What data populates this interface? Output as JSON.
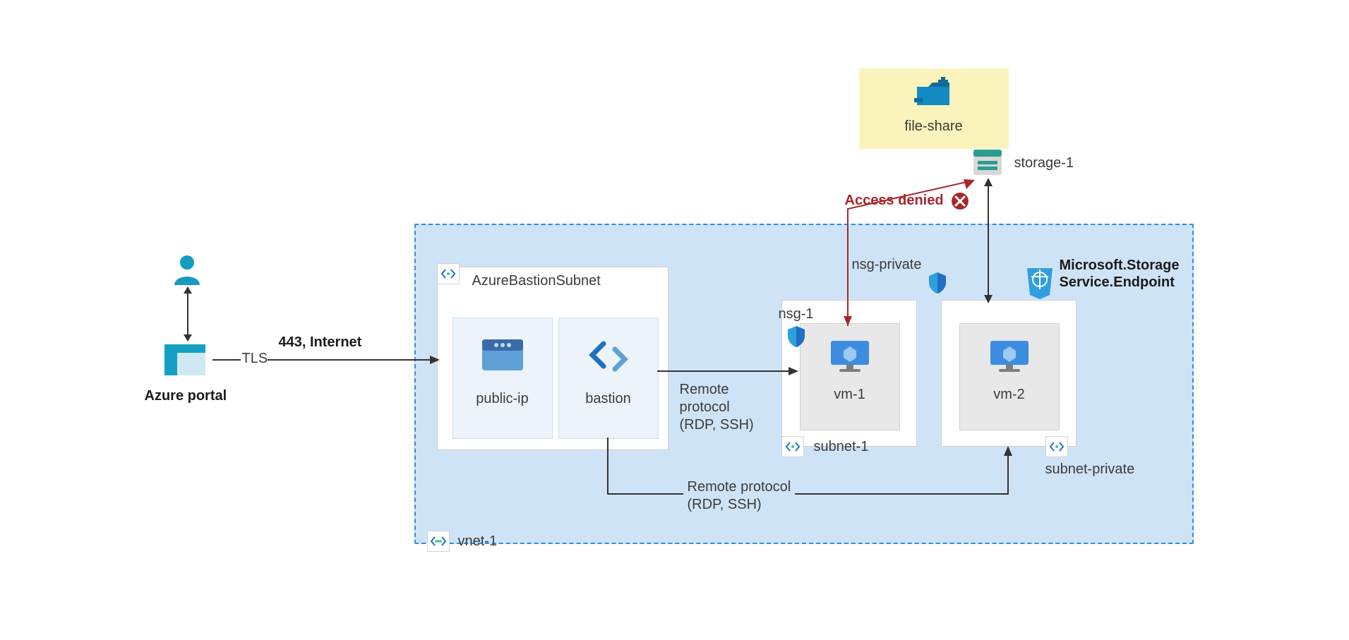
{
  "azure_portal_label": "Azure portal",
  "tls_label": "TLS",
  "internet_label": "443, Internet",
  "vnet_label": "vnet-1",
  "bastion_subnet_label": "AzureBastionSubnet",
  "public_ip_label": "public-ip",
  "bastion_label": "bastion",
  "remote_protocol_line1": "Remote",
  "remote_protocol_line2": "protocol",
  "remote_protocol_line3": "(RDP, SSH)",
  "remote_protocol_2_line1": "Remote protocol",
  "remote_protocol_2_line2": "(RDP, SSH)",
  "nsg1_label": "nsg-1",
  "vm1_label": "vm-1",
  "subnet1_label": "subnet-1",
  "nsg_private_label": "nsg-private",
  "vm2_label": "vm-2",
  "subnet_private_label": "subnet-private",
  "service_endpoint_line1": "Microsoft.Storage",
  "service_endpoint_line2": "Service.Endpoint",
  "access_denied_label": "Access denied",
  "file_share_label": "file-share",
  "storage_label": "storage-1"
}
